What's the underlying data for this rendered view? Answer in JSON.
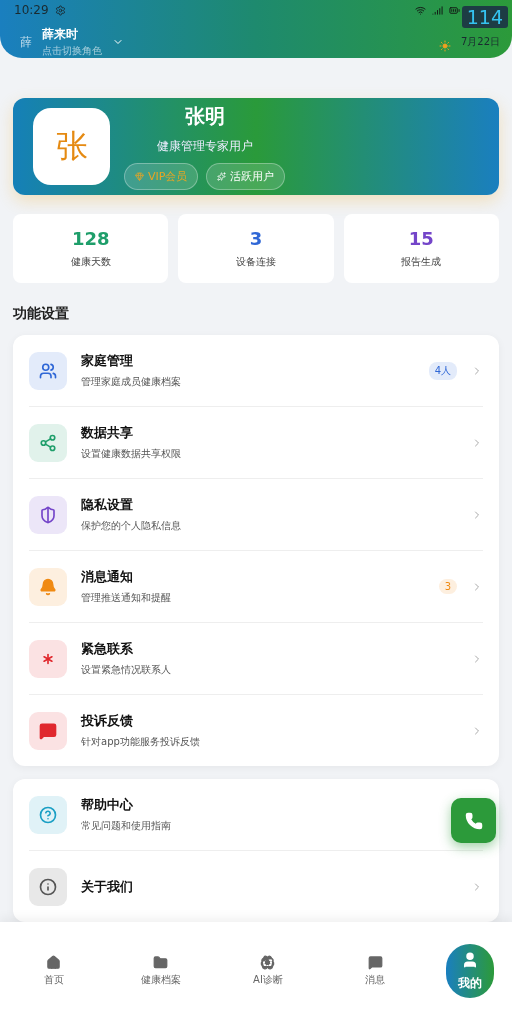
{
  "status_bar": {
    "time": "10:29",
    "overlay_number": "114"
  },
  "header": {
    "avatar_letter": "薛",
    "name": "薛来时",
    "hint": "点击切换角色",
    "date": "7月22日"
  },
  "profile": {
    "avatar_letter": "张",
    "name": "张明",
    "subtitle": "健康管理专家用户",
    "tags": [
      {
        "kind": "vip",
        "label": "VIP会员"
      },
      {
        "kind": "active",
        "label": "活跃用户"
      }
    ]
  },
  "stats": [
    {
      "value": "128",
      "label": "健康天数",
      "color": "#1e9e6a"
    },
    {
      "value": "3",
      "label": "设备连接",
      "color": "#2f67d6"
    },
    {
      "value": "15",
      "label": "报告生成",
      "color": "#7445c9"
    }
  ],
  "section_title": "功能设置",
  "settings": [
    {
      "title": "家庭管理",
      "subtitle": "管理家庭成员健康档案",
      "color": "#2f67d6",
      "badge": "4人"
    },
    {
      "title": "数据共享",
      "subtitle": "设置健康数据共享权限",
      "color": "#1e9e6a"
    },
    {
      "title": "隐私设置",
      "subtitle": "保护您的个人隐私信息",
      "color": "#7445c9"
    },
    {
      "title": "消息通知",
      "subtitle": "管理推送通知和提醒",
      "color": "#f08a12",
      "badge": "3"
    },
    {
      "title": "紧急联系",
      "subtitle": "设置紧急情况联系人",
      "color": "#e0282e"
    },
    {
      "title": "投诉反馈",
      "subtitle": "针对app功能服务投诉反馈",
      "color": "#e0282e"
    }
  ],
  "more": [
    {
      "title": "帮助中心",
      "subtitle": "常见问题和使用指南",
      "color": "#1a9fc4",
      "chevron_visible": false
    },
    {
      "title": "关于我们",
      "color": "#555555"
    }
  ],
  "nav": [
    {
      "label": "首页",
      "selected": false
    },
    {
      "label": "健康档案",
      "selected": false
    },
    {
      "label": "AI诊断",
      "selected": false
    },
    {
      "label": "消息",
      "selected": false
    },
    {
      "label": "我的",
      "selected": true
    }
  ]
}
